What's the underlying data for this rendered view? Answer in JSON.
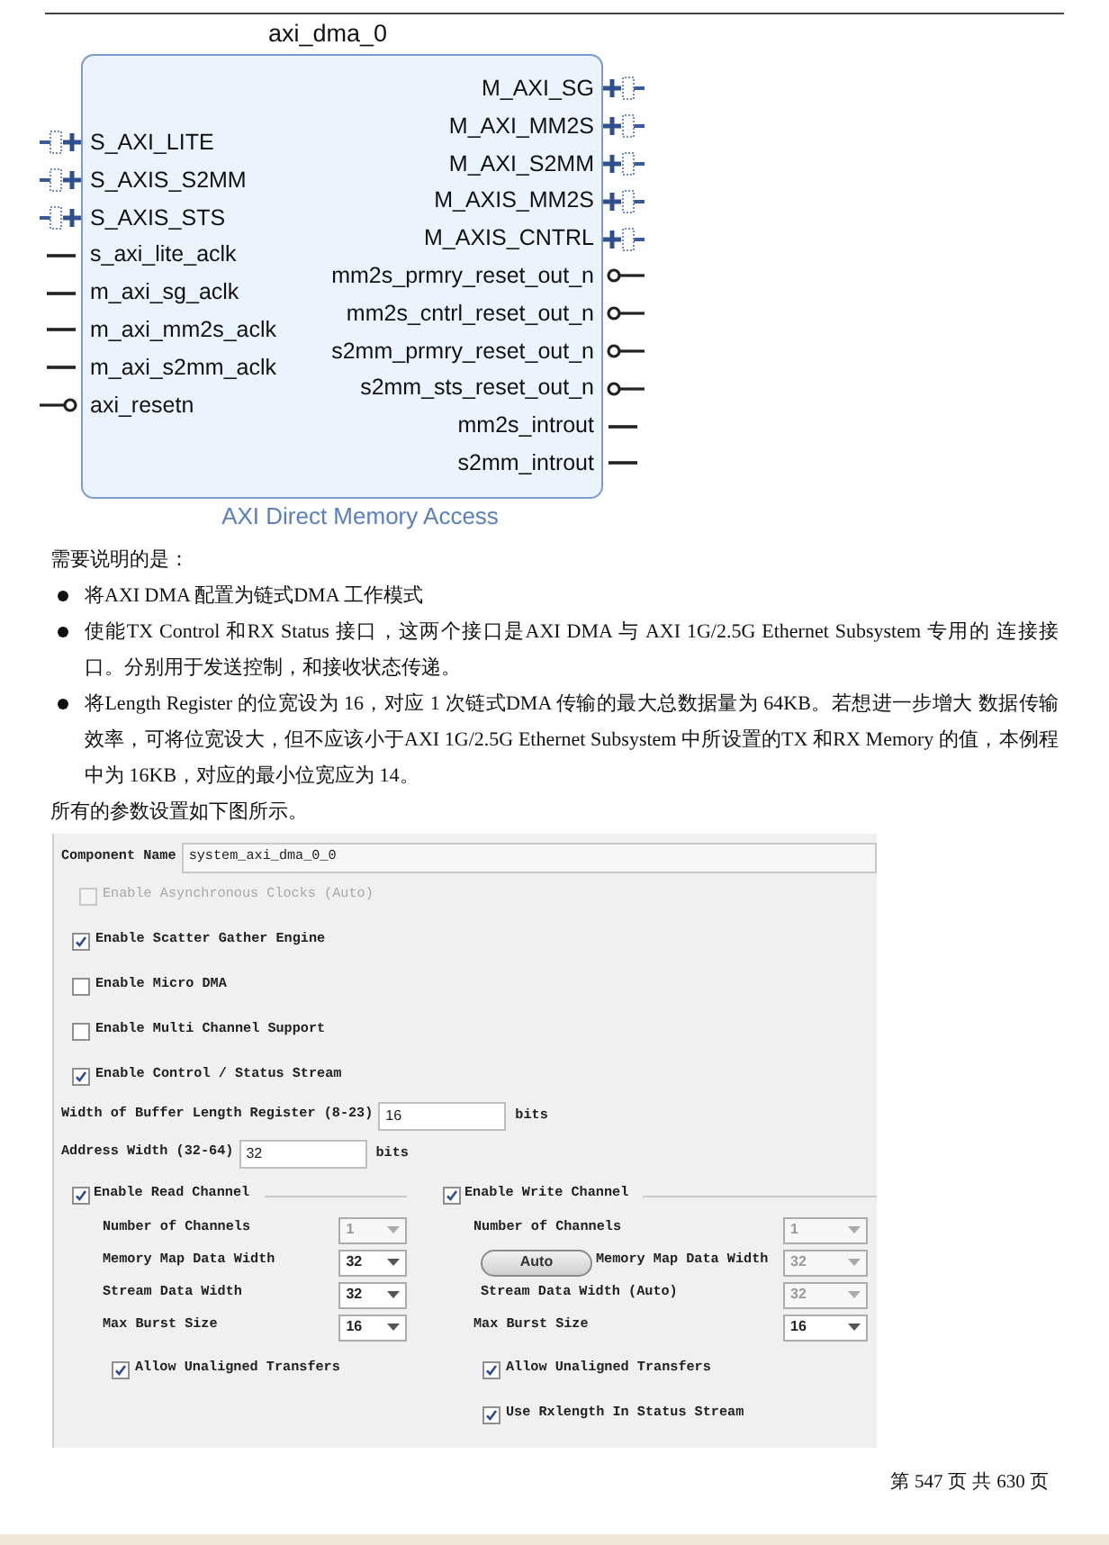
{
  "diagram": {
    "title": "axi_dma_0",
    "caption": "AXI Direct Memory Access",
    "left_ports": [
      {
        "label": "S_AXI_LITE",
        "kind": "bus"
      },
      {
        "label": "S_AXIS_S2MM",
        "kind": "bus"
      },
      {
        "label": "S_AXIS_STS",
        "kind": "bus"
      },
      {
        "label": "s_axi_lite_aclk",
        "kind": "clock"
      },
      {
        "label": "m_axi_sg_aclk",
        "kind": "clock"
      },
      {
        "label": "m_axi_mm2s_aclk",
        "kind": "clock"
      },
      {
        "label": "m_axi_s2mm_aclk",
        "kind": "clock"
      },
      {
        "label": "axi_resetn",
        "kind": "reset"
      }
    ],
    "right_ports": [
      {
        "label": "M_AXI_SG",
        "kind": "bus"
      },
      {
        "label": "M_AXI_MM2S",
        "kind": "bus"
      },
      {
        "label": "M_AXI_S2MM",
        "kind": "bus"
      },
      {
        "label": "M_AXIS_MM2S",
        "kind": "bus"
      },
      {
        "label": "M_AXIS_CNTRL",
        "kind": "bus"
      },
      {
        "label": "mm2s_prmry_reset_out_n",
        "kind": "reset"
      },
      {
        "label": "mm2s_cntrl_reset_out_n",
        "kind": "reset"
      },
      {
        "label": "s2mm_prmry_reset_out_n",
        "kind": "reset"
      },
      {
        "label": "s2mm_sts_reset_out_n",
        "kind": "reset"
      },
      {
        "label": "mm2s_introut",
        "kind": "clock"
      },
      {
        "label": "s2mm_introut",
        "kind": "clock"
      }
    ]
  },
  "notes": {
    "intro": "需要说明的是：",
    "bullets": [
      "将AXI DMA  配置为链式DMA  工作模式",
      "使能TX Control  和RX Status  接口，这两个接口是AXI DMA  与  AXI 1G/2.5G Ethernet Subsystem  专用的  连接接口。分别用于发送控制，和接收状态传递。",
      "将Length Register  的位宽设为  16，对应  1  次链式DMA  传输的最大总数据量为  64KB。若想进一步增大  数据传输效率，可将位宽设大，但不应该小于AXI 1G/2.5G Ethernet Subsystem  中所设置的TX  和RX Memory  的值，本例程中为  16KB，对应的最小位宽应为  14。"
    ],
    "outro": "所有的参数设置如下图所示。"
  },
  "config": {
    "component_name": {
      "label": "Component Name",
      "value": "system_axi_dma_0_0"
    },
    "options": [
      {
        "label": "Enable Asynchronous Clocks (Auto)",
        "checked": false,
        "disabled": true
      },
      {
        "label": "Enable Scatter Gather Engine",
        "checked": true,
        "disabled": false
      },
      {
        "label": "Enable Micro DMA",
        "checked": false,
        "disabled": false
      },
      {
        "label": "Enable Multi Channel Support",
        "checked": false,
        "disabled": false
      },
      {
        "label": "Enable Control / Status Stream",
        "checked": true,
        "disabled": false
      }
    ],
    "widths": [
      {
        "label": "Width of Buffer Length Register (8-23)",
        "value": "16",
        "unit": "bits"
      },
      {
        "label": "Address Width (32-64)",
        "value": "32",
        "unit": "bits"
      }
    ],
    "channels": [
      {
        "label": "Enable Read Channel",
        "checked": true,
        "fields": [
          {
            "label": "Number of Channels",
            "value": "1",
            "disabled": true,
            "kind": "plain"
          },
          {
            "label": "Memory Map Data Width",
            "value": "32",
            "disabled": false,
            "kind": "plain"
          },
          {
            "label": "Stream Data Width",
            "value": "32",
            "disabled": false,
            "kind": "plain"
          },
          {
            "label": "Max Burst Size",
            "value": "16",
            "disabled": false,
            "kind": "plain"
          }
        ],
        "options": [
          {
            "label": "Allow Unaligned Transfers",
            "checked": true
          }
        ]
      },
      {
        "label": "Enable Write Channel",
        "checked": true,
        "fields": [
          {
            "label": "Number of Channels",
            "value": "1",
            "disabled": true,
            "kind": "plain"
          },
          {
            "label": "Memory Map Data Width",
            "value": "32",
            "disabled": true,
            "kind": "toggle",
            "toggle": "Auto"
          },
          {
            "label": "Stream Data Width (Auto)",
            "value": "32",
            "disabled": true,
            "kind": "plain"
          },
          {
            "label": "Max Burst Size",
            "value": "16",
            "disabled": false,
            "kind": "plain"
          }
        ],
        "options": [
          {
            "label": "Allow Unaligned Transfers",
            "checked": true
          },
          {
            "label": "Use Rxlength In Status Stream",
            "checked": true
          }
        ]
      }
    ]
  },
  "footer": "第 547 页 共 630 页"
}
